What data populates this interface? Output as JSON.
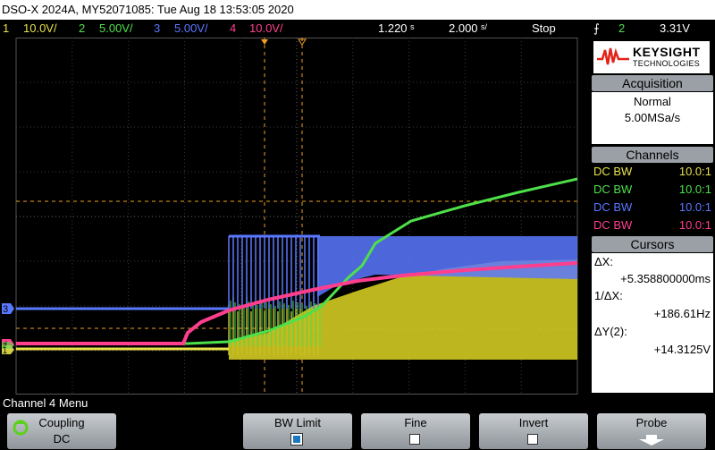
{
  "window": {
    "title": "DSO-X 2024A, MY52071085: Tue Aug 18 13:53:05 2020"
  },
  "channels_bar": [
    {
      "num": "1",
      "scale": "10.0V/",
      "color": "#e8e24a"
    },
    {
      "num": "2",
      "scale": "5.00V/",
      "color": "#4ee04a"
    },
    {
      "num": "3",
      "scale": "5.00V/",
      "color": "#5a78ff"
    },
    {
      "num": "4",
      "scale": "10.0V/",
      "color": "#ff3f8e"
    }
  ],
  "timebase": {
    "delay": "1.220",
    "delay_unit": "s",
    "scale": "2.000",
    "scale_unit": "s/",
    "state": "Stop"
  },
  "trigger": {
    "symbol": "⨍",
    "channel": "2",
    "level": "3.31V"
  },
  "logo": {
    "name": "KEYSIGHT",
    "sub": "TECHNOLOGIES"
  },
  "acquisition": {
    "header": "Acquisition",
    "mode": "Normal",
    "rate": "5.00MSa/s"
  },
  "channels_panel": {
    "header": "Channels",
    "rows": [
      {
        "left": "DC BW",
        "right": "10.0:1",
        "color": "#e8e24a"
      },
      {
        "left": "DC BW",
        "right": "10.0:1",
        "color": "#4ee04a"
      },
      {
        "left": "DC BW",
        "right": "10.0:1",
        "color": "#5a78ff"
      },
      {
        "left": "DC BW",
        "right": "10.0:1",
        "color": "#ff3f8e"
      }
    ]
  },
  "cursors": {
    "header": "Cursors",
    "dx_label": "ΔX:",
    "dx_value": "+5.358800000ms",
    "inv_label": "1/ΔX:",
    "inv_value": "+186.61Hz",
    "dy_label": "ΔY(2):",
    "dy_value": "+14.3125V"
  },
  "markers": {
    "ch1": "1",
    "ch2": "2",
    "ch3": "3",
    "ch4": "4"
  },
  "menu": {
    "title": "Channel 4 Menu"
  },
  "softkeys": [
    {
      "label": "Coupling",
      "value": "DC"
    },
    {
      "label": "BW Limit",
      "checked": true
    },
    {
      "label": "Fine",
      "checked": false
    },
    {
      "label": "Invert",
      "checked": false
    },
    {
      "label": "Probe"
    }
  ]
}
